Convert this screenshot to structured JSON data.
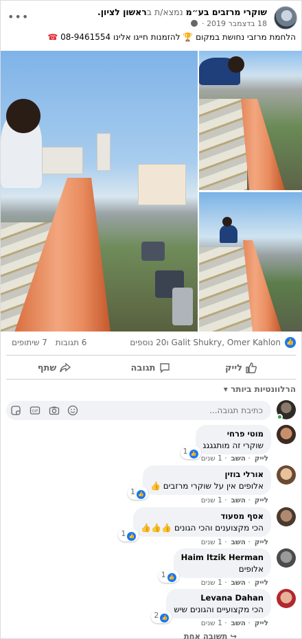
{
  "post": {
    "page_name": "שוקרי מרזבים בע״מ",
    "location_prefix": "נמצא/ת ב",
    "location": "ראשון לציון.",
    "date": "18 בדצמבר 2019",
    "text_part1": "הלחמת מרזבי נחושת במקום",
    "text_part2": "להזמנות חייגו אלינו 08-9461554",
    "more_icon": "ellipsis-icon",
    "globe_icon": "globe-icon"
  },
  "stats": {
    "reactors": "Galit Shukry, Omer Kahlon ו20 נוספים",
    "comments": "6 תגובות",
    "shares": "7 שיתופים"
  },
  "actions": {
    "like": "לייק",
    "comment": "תגובה",
    "share": "שתף"
  },
  "relevance": "הרלוונטיות ביותר",
  "write_comment": {
    "placeholder": "כתיבת תגובה..."
  },
  "comments": [
    {
      "name": "מוטי פרחי",
      "text": "שוקרי זה מותגגגג",
      "likes": "1",
      "meta_like": "לייק",
      "meta_reply": "השב",
      "meta_time": "1 שנים"
    },
    {
      "name": "אורלי בוזין",
      "text": "אלופים אין על שוקרי מרזבים",
      "emoji": "👍",
      "likes": "1",
      "meta_like": "לייק",
      "meta_reply": "השב",
      "meta_time": "1 שנים"
    },
    {
      "name": "אסף מסעוד",
      "text": "הכי מקצוענים והכי הגונים",
      "emoji": "👍👍👍",
      "likes": "1",
      "meta_like": "לייק",
      "meta_reply": "השב",
      "meta_time": "1 שנים"
    },
    {
      "name": "Haim Itzik Herman",
      "text": "אלופים",
      "likes": "1",
      "meta_like": "לייק",
      "meta_reply": "השב",
      "meta_time": "1 שנים"
    },
    {
      "name": "Levana Dahan",
      "text": "הכי מקצועיים והגונים שיש",
      "likes": "2",
      "meta_like": "לייק",
      "meta_reply": "השב",
      "meta_time": "1 שנים"
    }
  ],
  "reply_more": "תשובה אחת",
  "colors": {
    "facebook_blue": "#1877f2",
    "muted": "#65676b",
    "bubble": "#f0f2f5"
  }
}
